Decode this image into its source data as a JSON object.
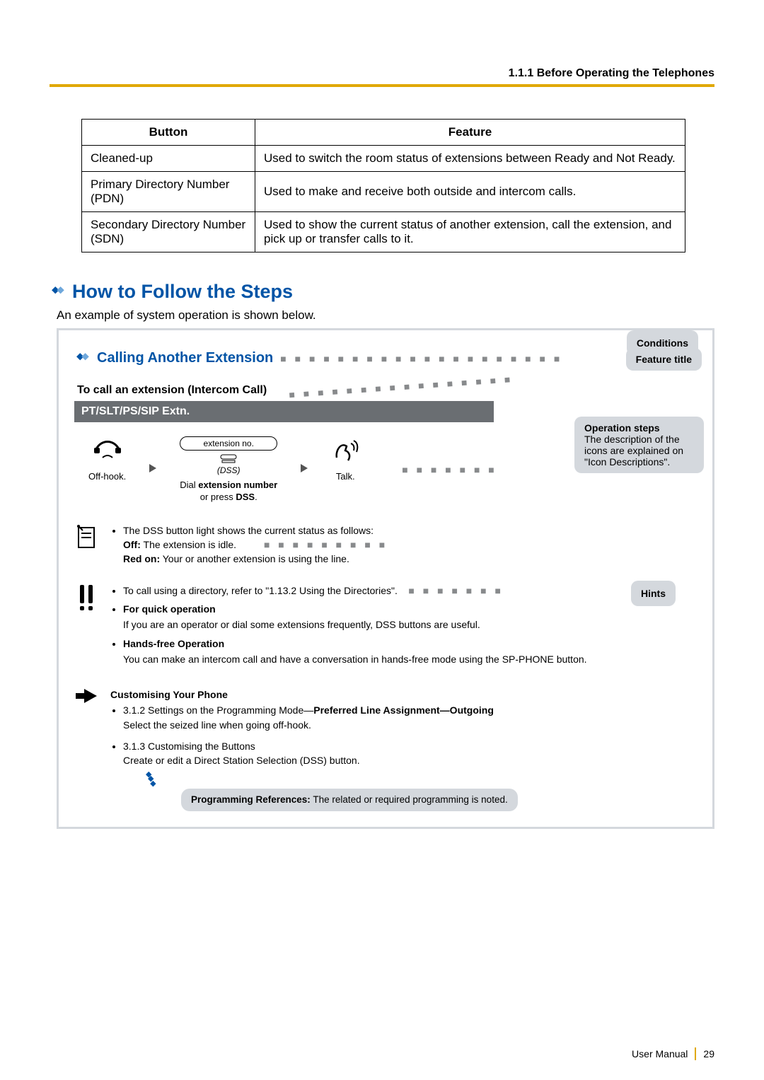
{
  "header": {
    "breadcrumb": "1.1.1 Before Operating the Telephones"
  },
  "table": {
    "headers": {
      "col1": "Button",
      "col2": "Feature"
    },
    "rows": [
      {
        "button": "Cleaned-up",
        "feature": "Used to switch the room status of extensions between Ready and Not Ready."
      },
      {
        "button": "Primary Directory Number (PDN)",
        "feature": "Used to make and receive both outside and intercom calls."
      },
      {
        "button": "Secondary Directory Number (SDN)",
        "feature": "Used to show the current status of another extension, call the extension, and pick up or transfer calls to it."
      }
    ]
  },
  "section": {
    "title": "How to Follow the Steps",
    "intro": "An example of system operation is shown below."
  },
  "example": {
    "feature_title": "Calling Another Extension",
    "callouts": {
      "feature_title": "Feature title",
      "operation_steps_bold": "Operation steps",
      "operation_steps_rest": "The description of the icons are explained on \"Icon Descriptions\".",
      "conditions": "Conditions",
      "hints": "Hints"
    },
    "sub_head": "To call an extension (Intercom Call)",
    "ext_bar": "PT/SLT/PS/SIP Extn.",
    "steps": {
      "off_hook": "Off-hook.",
      "ext_no_label": "extension no.",
      "dss_label": "(DSS)",
      "dial_line1": "Dial ",
      "dial_bold": "extension number",
      "dial_line2": "or press ",
      "dial_bold2": "DSS",
      "dial_period": ".",
      "talk": "Talk."
    },
    "conditions_block": {
      "line1": "The DSS button light shows the current status as follows:",
      "off_bold": "Off:",
      "off_rest": " The extension is idle.",
      "red_bold": "Red on:",
      "red_rest": " Your or another extension is using the line."
    },
    "hints_block": {
      "directory": "To call using a directory, refer to \"1.13.2 Using the Directories\".",
      "quick_title": "For quick operation",
      "quick_body": "If you are an operator or dial some extensions frequently, DSS buttons are useful.",
      "hands_title": "Hands-free Operation",
      "hands_body": "You can make an intercom call and have a conversation in hands-free mode using the SP-PHONE button."
    },
    "custom_block": {
      "title": "Customising Your Phone",
      "item1_prefix": "3.1.2 Settings on the Programming Mode—",
      "item1_bold": "Preferred Line Assignment—Outgoing",
      "item1_body": "Select the seized line when going off-hook.",
      "item2_title": "3.1.3 Customising the Buttons",
      "item2_body": "Create or edit a Direct Station Selection (DSS) button."
    },
    "prog_ref_bold": "Programming References:",
    "prog_ref_rest": " The related or required programming is noted."
  },
  "footer": {
    "left": "User Manual",
    "page": "29"
  }
}
